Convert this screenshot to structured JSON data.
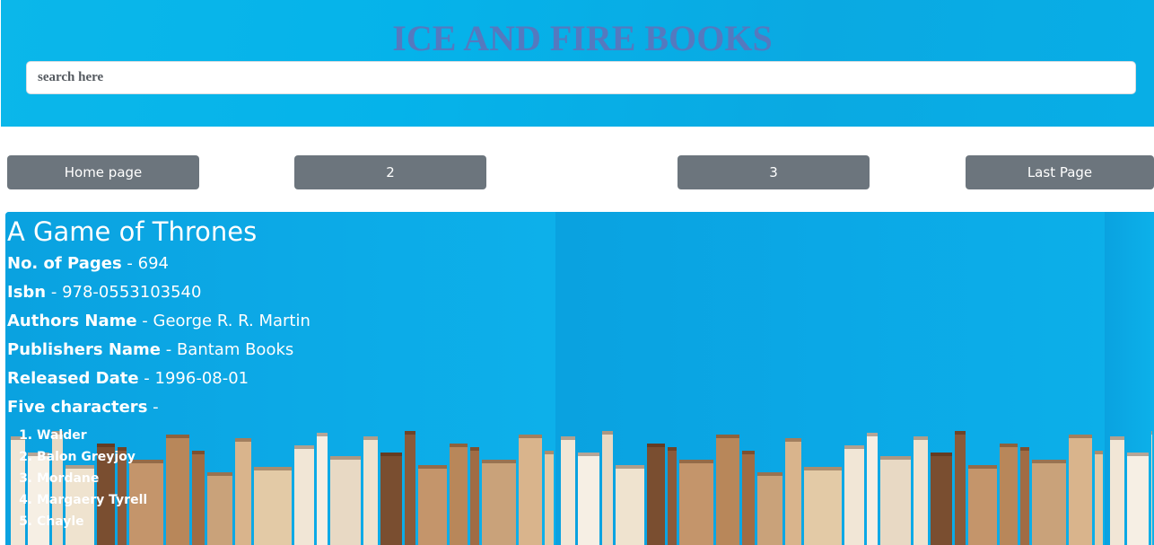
{
  "header": {
    "title": "ICE AND FIRE BOOKS",
    "search_placeholder": "search here",
    "search_value": ""
  },
  "pagination": {
    "home_label": "Home page",
    "page2_label": "2",
    "page3_label": "3",
    "last_label": "Last Page"
  },
  "book": {
    "title": "A Game of Thrones",
    "pages_label": "No. of Pages",
    "pages_value": "694",
    "isbn_label": "Isbn",
    "isbn_value": "978-0553103540",
    "authors_label": "Authors Name",
    "authors_value": "George R. R. Martin",
    "publisher_label": "Publishers Name",
    "publisher_value": "Bantam Books",
    "released_label": "Released Date",
    "released_value": "1996-08-01",
    "characters_label": "Five characters",
    "separator": " - ",
    "characters": [
      "Walder",
      "Balon Greyjoy",
      "Mordane",
      "Margaery Tyrell",
      "Chayle"
    ]
  },
  "colors": {
    "header_bg": "#05b3ea",
    "title_color": "#5579bf",
    "button_bg": "#6c757d",
    "card_bg": "#0aaee8",
    "text_on_card": "#ffffff"
  }
}
